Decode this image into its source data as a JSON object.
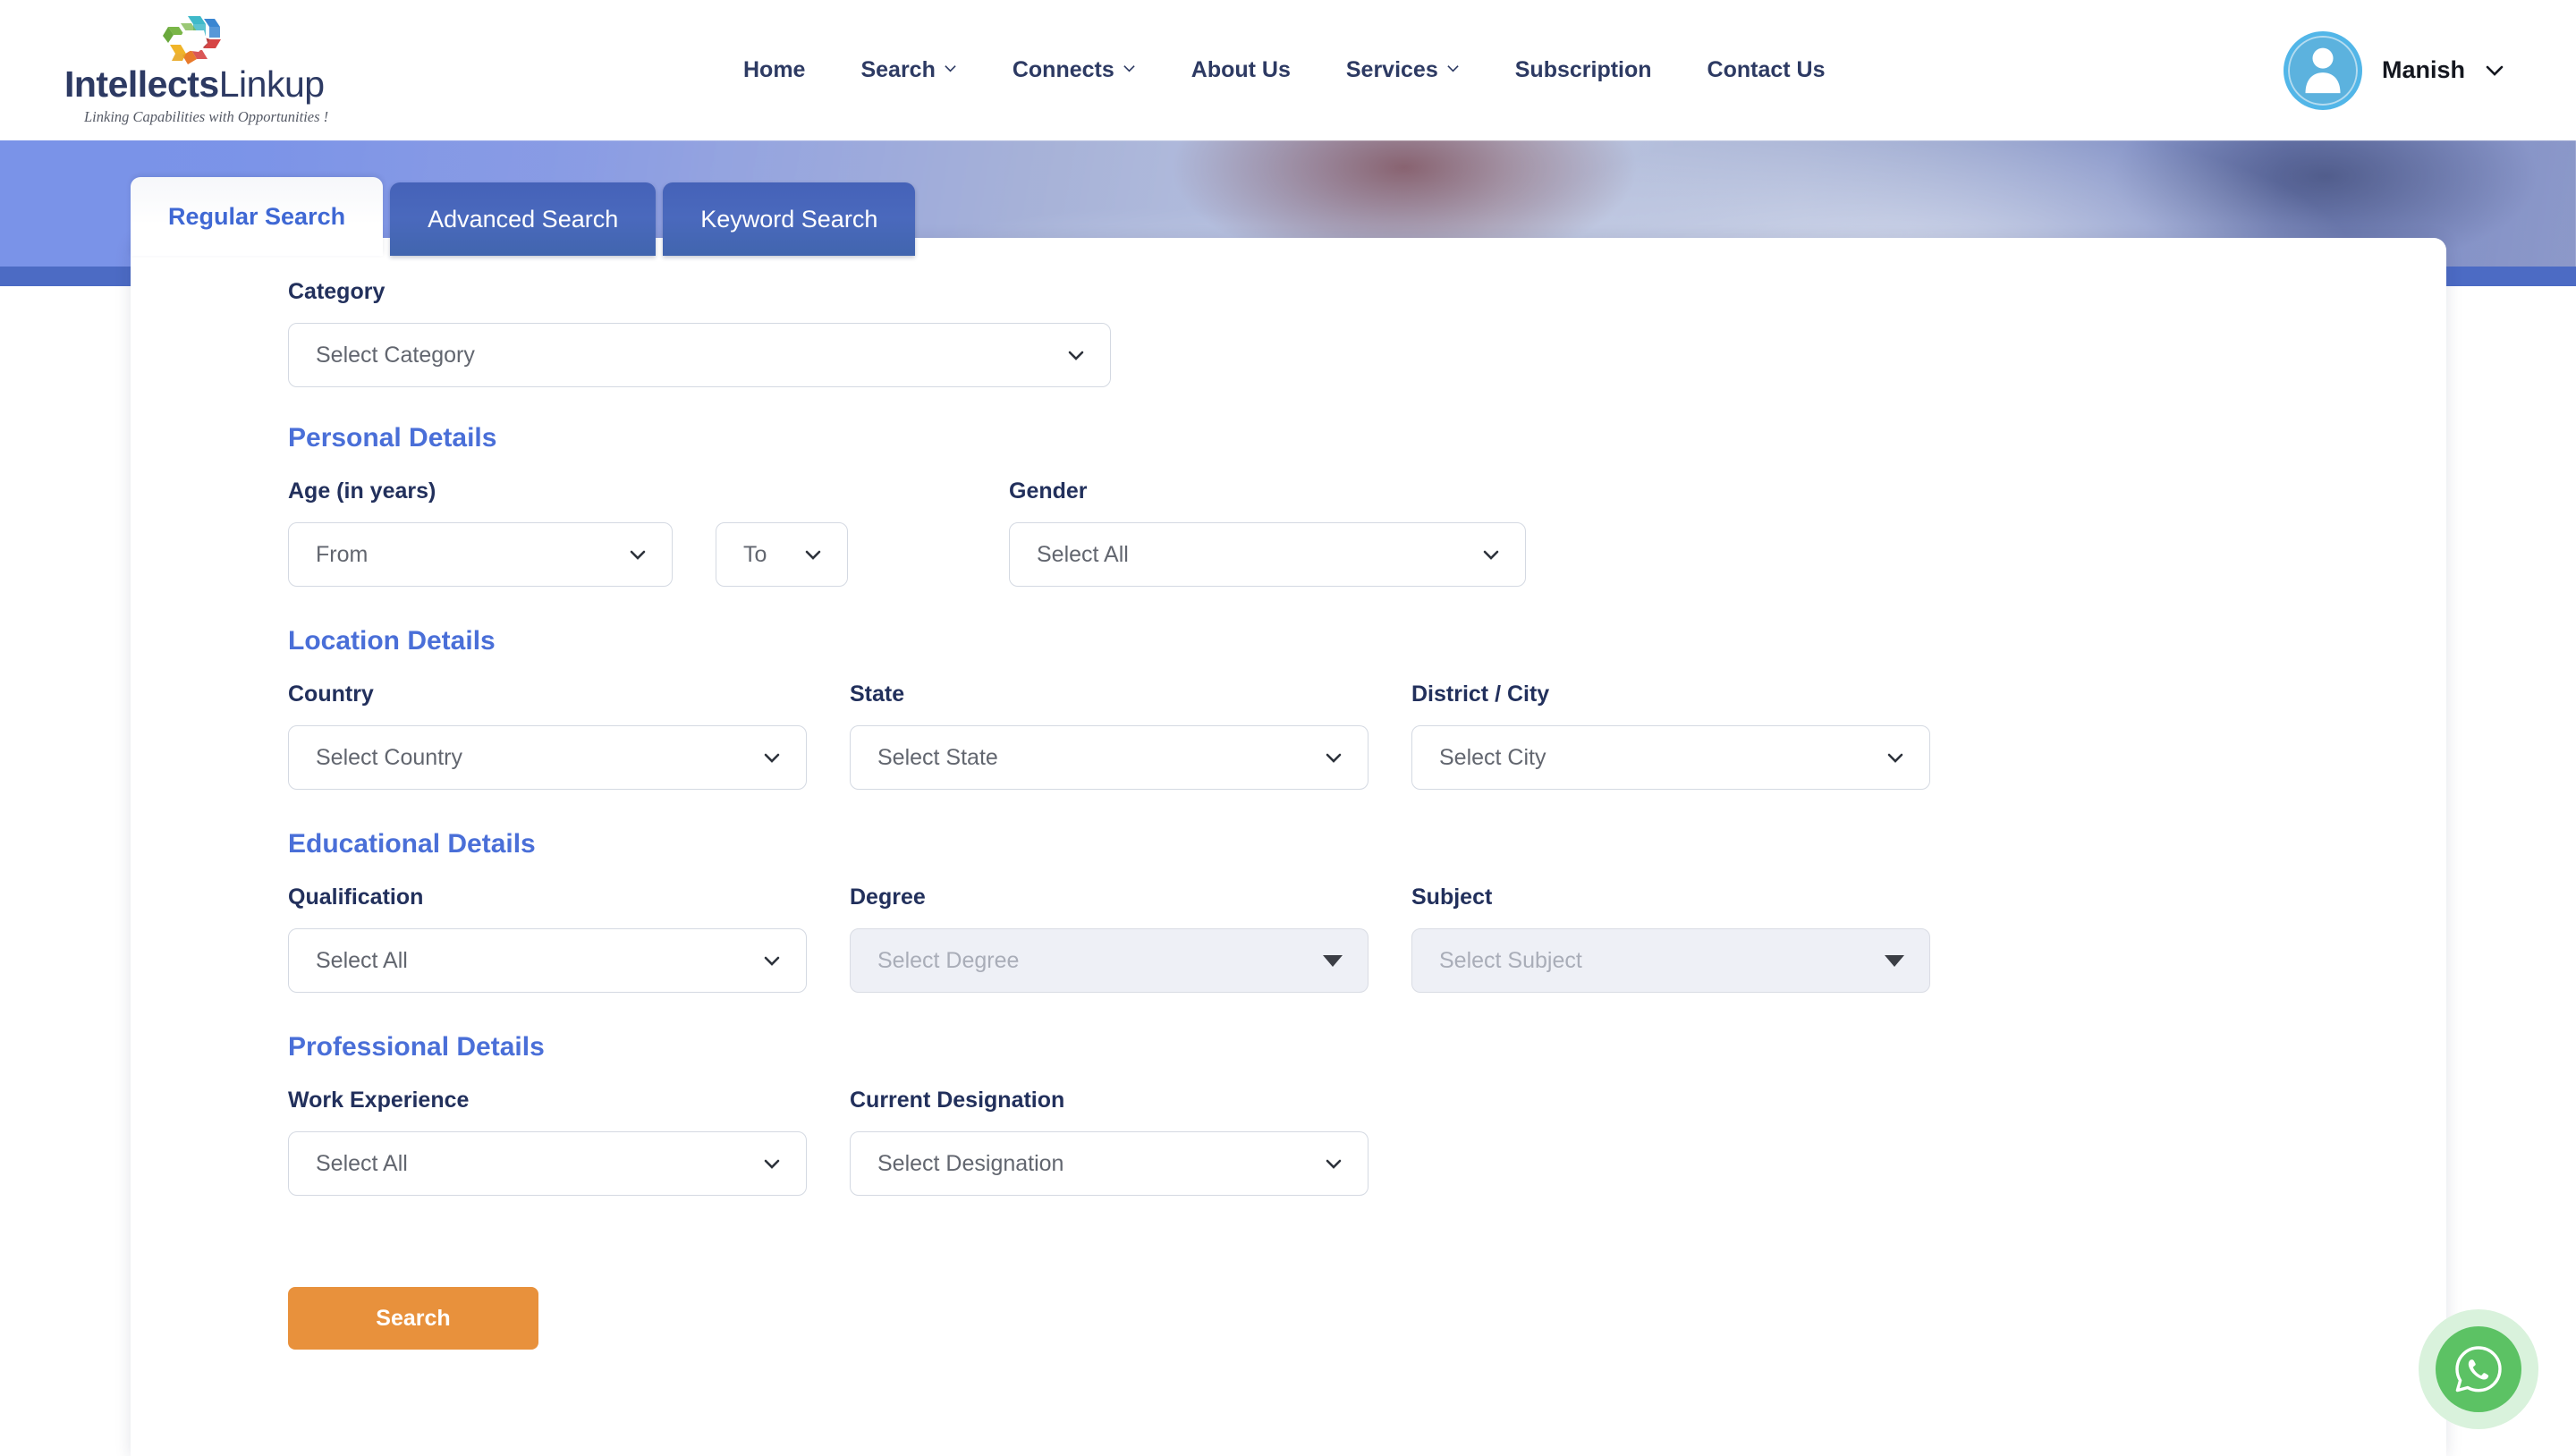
{
  "brand": {
    "name_bold": "Intellects",
    "name_light": "Linkup",
    "tagline": "Linking Capabilities with Opportunities !",
    "logo_colors": [
      "#3fb9c9",
      "#3a86d1",
      "#d64545",
      "#f0b429",
      "#e87a2b",
      "#7ab648"
    ]
  },
  "nav": {
    "items": [
      {
        "label": "Home",
        "has_dropdown": false
      },
      {
        "label": "Search",
        "has_dropdown": true
      },
      {
        "label": "Connects",
        "has_dropdown": true
      },
      {
        "label": "About Us",
        "has_dropdown": false
      },
      {
        "label": "Services",
        "has_dropdown": true
      },
      {
        "label": "Subscription",
        "has_dropdown": false
      },
      {
        "label": "Contact Us",
        "has_dropdown": false
      }
    ]
  },
  "user": {
    "name": "Manish",
    "avatar_icon": "user-avatar-icon",
    "caret_icon": "chevron-down-icon"
  },
  "tabs": [
    {
      "label": "Regular Search",
      "active": true
    },
    {
      "label": "Advanced Search",
      "active": false
    },
    {
      "label": "Keyword Search",
      "active": false
    }
  ],
  "form": {
    "category": {
      "label": "Category",
      "placeholder": "Select Category",
      "value": "Select Category",
      "disabled": false
    },
    "personal": {
      "section_title": "Personal Details",
      "age_label": "Age (in years)",
      "age_from": {
        "placeholder": "From",
        "value": "From",
        "disabled": false
      },
      "age_to": {
        "placeholder": "To",
        "value": "To",
        "disabled": false
      },
      "gender_label": "Gender",
      "gender": {
        "placeholder": "Select All",
        "value": "Select All",
        "disabled": false
      }
    },
    "location": {
      "section_title": "Location Details",
      "country_label": "Country",
      "country": {
        "placeholder": "Select Country",
        "value": "Select Country",
        "disabled": false
      },
      "state_label": "State",
      "state": {
        "placeholder": "Select State",
        "value": "Select State",
        "disabled": false
      },
      "city_label": "District / City",
      "city": {
        "placeholder": "Select City",
        "value": "Select City",
        "disabled": false
      }
    },
    "education": {
      "section_title": "Educational Details",
      "qualification_label": "Qualification",
      "qualification": {
        "placeholder": "Select All",
        "value": "Select All",
        "disabled": false
      },
      "degree_label": "Degree",
      "degree": {
        "placeholder": "Select Degree",
        "value": "Select Degree",
        "disabled": true
      },
      "subject_label": "Subject",
      "subject": {
        "placeholder": "Select Subject",
        "value": "Select Subject",
        "disabled": true
      }
    },
    "professional": {
      "section_title": "Professional Details",
      "experience_label": "Work Experience",
      "experience": {
        "placeholder": "Select All",
        "value": "Select All",
        "disabled": false
      },
      "designation_label": "Current Designation",
      "designation": {
        "placeholder": "Select Designation",
        "value": "Select Designation",
        "disabled": false
      }
    },
    "submit_label": "Search"
  },
  "floating": {
    "whatsapp_icon": "whatsapp-icon"
  },
  "colors": {
    "nav_text": "#2d3a63",
    "section_title": "#4a6fd8",
    "label": "#22305c",
    "tab_active_text": "#3f68d4",
    "tab_inactive_bg": "#4a69bd",
    "submit_bg": "#e8913c",
    "banner_blue": "#7a93e8",
    "banner_stripe": "#4c6bc4",
    "whatsapp_green": "#5cc264",
    "avatar_blue": "#52b6e8",
    "disabled_bg": "#eef0f6"
  }
}
